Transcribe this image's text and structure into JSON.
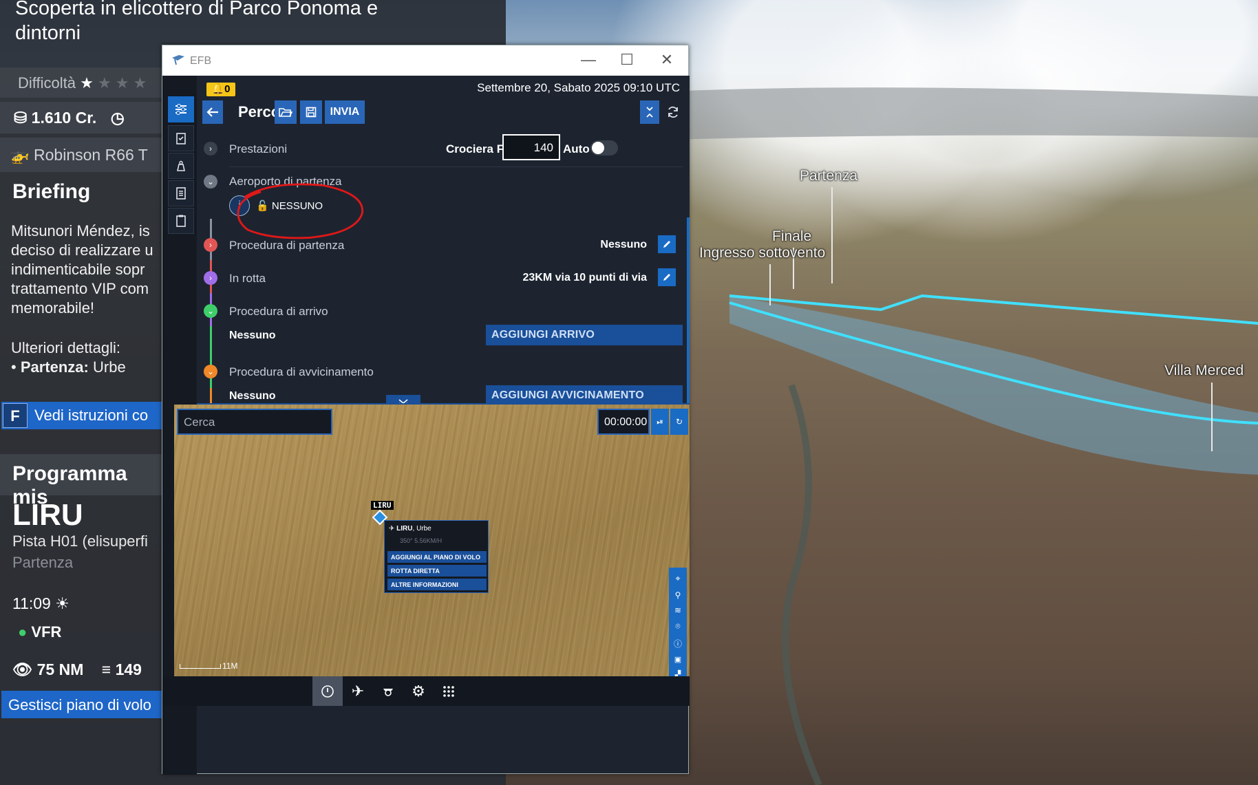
{
  "world": {
    "labels": {
      "partenza": "Partenza",
      "finale": "Finale",
      "ingresso": "Ingresso sottovento",
      "villa": "Villa Merced"
    }
  },
  "mission": {
    "title": "Scoperta in elicottero di Parco Ponoma e dintorni",
    "difficulty_label": "Difficoltà",
    "credits": "1.610 Cr.",
    "aircraft": "Robinson R66 T",
    "briefing_heading": "Briefing",
    "briefing_text": "Mitsunori Méndez, is deciso di realizzare u indimenticabile sopr trattamento VIP com memorabile!",
    "more_details": "Ulteriori dettagli:",
    "departure_label": "Partenza:",
    "departure_value": "Urbe",
    "instructions_key": "F",
    "instructions_button": "Vedi istruzioni co",
    "program_heading": "Programma mis",
    "airport_code": "LIRU",
    "runway": "Pista H01 (elisuperfi",
    "runway_role": "Partenza",
    "time": "11:09",
    "flight_rules": "VFR",
    "visibility": "75",
    "visibility_unit": "NM",
    "wind": "149",
    "manage_button": "Gestisci piano di volo"
  },
  "efb": {
    "window_title": "EFB",
    "notifications": "0",
    "datetime": "Settembre 20, Sabato 2025 09:10 UTC",
    "route_title": "Percorso",
    "send_button": "INVIA",
    "performance": {
      "label": "Prestazioni",
      "cruise_label": "Crociera FL",
      "cruise_value": "140",
      "auto_label": "Auto"
    },
    "departure_airport": {
      "label": "Aeroporto di partenza",
      "value": "NESSUNO"
    },
    "departure_procedure": {
      "label": "Procedura di partenza",
      "value": "Nessuno"
    },
    "enroute": {
      "label": "In rotta",
      "value": "23KM via 10 punti di via"
    },
    "arrival": {
      "label": "Procedura di arrivo",
      "value": "Nessuno",
      "button": "AGGIUNGI ARRIVO"
    },
    "approach": {
      "label": "Procedura di avvicinamento",
      "value": "Nessuno",
      "button": "AGGIUNGI AVVICINAMENTO"
    },
    "map": {
      "search_placeholder": "Cerca",
      "timer": "00:00:00",
      "airport_tag": "LIRU",
      "popup_title_code": "LIRU",
      "popup_title_name": ", Urbe",
      "popup_sub": "350° 5.56KM/H",
      "popup_actions": [
        "AGGIUNGI AL PIANO DI VOLO",
        "ROTTA DIRETTA",
        "ALTRE INFORMAZIONI"
      ],
      "scale": "11M"
    }
  }
}
